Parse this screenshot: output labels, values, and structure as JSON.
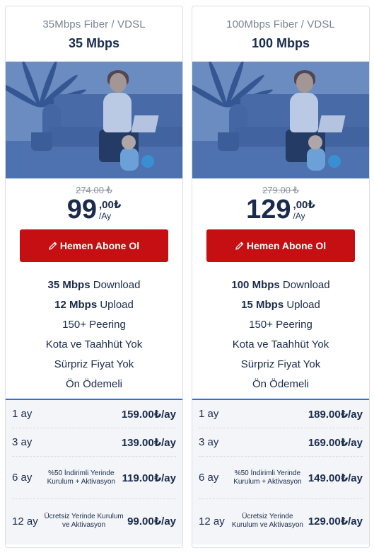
{
  "plans": [
    {
      "subtitle": "35Mbps Fiber / VDSL",
      "title": "35 Mbps",
      "old_price": "274.00 ₺",
      "price_int": "99",
      "price_dec": ",00₺",
      "price_per": "/Ay",
      "button_label": "Hemen Abone Ol",
      "features": [
        {
          "bold": "35 Mbps",
          "rest": " Download"
        },
        {
          "bold": "12 Mbps",
          "rest": " Upload"
        },
        {
          "bold": "",
          "rest": "150+ Peering"
        },
        {
          "bold": "",
          "rest": "Kota ve Taahhüt Yok"
        },
        {
          "bold": "",
          "rest": "Sürpriz Fiyat Yok"
        },
        {
          "bold": "",
          "rest": "Ön Ödemeli"
        }
      ],
      "periods": [
        {
          "label": "1 ay",
          "note": "",
          "price": "159.00₺/ay"
        },
        {
          "label": "3 ay",
          "note": "",
          "price": "139.00₺/ay"
        },
        {
          "label": "6 ay",
          "note": "%50 İndirimli Yerinde Kurulum + Aktivasyon",
          "price": "119.00₺/ay"
        },
        {
          "label": "12 ay",
          "note": "Ücretsiz Yerinde Kurulum ve Aktivasyon",
          "price": "99.00₺/ay"
        }
      ]
    },
    {
      "subtitle": "100Mbps Fiber / VDSL",
      "title": "100 Mbps",
      "old_price": "279.00 ₺",
      "price_int": "129",
      "price_dec": ",00₺",
      "price_per": "/Ay",
      "button_label": "Hemen Abone Ol",
      "features": [
        {
          "bold": "100 Mbps",
          "rest": " Download"
        },
        {
          "bold": "15 Mbps",
          "rest": " Upload"
        },
        {
          "bold": "",
          "rest": "150+ Peering"
        },
        {
          "bold": "",
          "rest": "Kota ve Taahhüt Yok"
        },
        {
          "bold": "",
          "rest": "Sürpriz Fiyat Yok"
        },
        {
          "bold": "",
          "rest": "Ön Ödemeli"
        }
      ],
      "periods": [
        {
          "label": "1 ay",
          "note": "",
          "price": "189.00₺/ay"
        },
        {
          "label": "3 ay",
          "note": "",
          "price": "169.00₺/ay"
        },
        {
          "label": "6 ay",
          "note": "%50 İndirimli Yerinde Kurulum + Aktivasyon",
          "price": "149.00₺/ay"
        },
        {
          "label": "12 ay",
          "note": "Ücretsiz Yerinde Kurulum ve Aktivasyon",
          "price": "129.00₺/ay"
        }
      ]
    }
  ],
  "icons": {
    "button_icon": "pencil-icon",
    "photo": "family-photo"
  },
  "colors": {
    "button": "#c50f12",
    "accent_line": "#2f6fd6",
    "text": "#1a2b4c"
  }
}
